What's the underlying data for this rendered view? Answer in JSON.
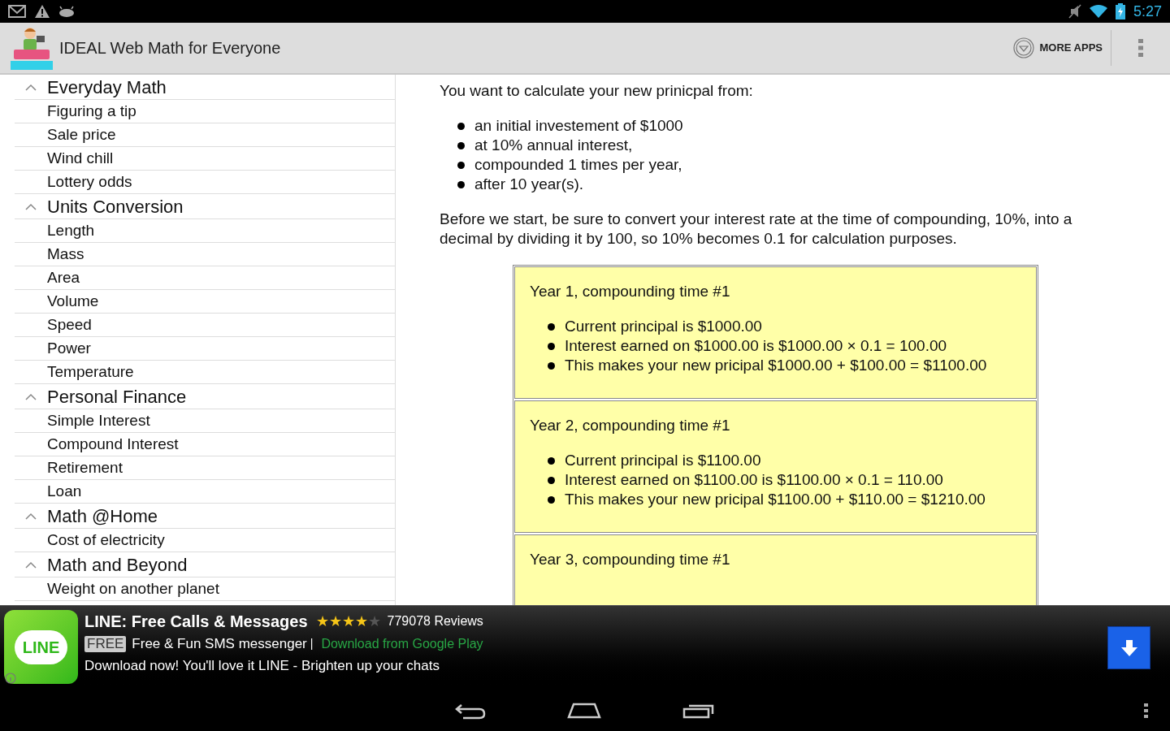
{
  "status_bar": {
    "time": "5:27"
  },
  "action_bar": {
    "title": "IDEAL Web Math for Everyone",
    "more_apps": "MORE APPS"
  },
  "sidebar": {
    "groups": [
      {
        "label": "Everyday Math",
        "expanded": true,
        "children": [
          {
            "label": "Figuring a tip"
          },
          {
            "label": "Sale price"
          },
          {
            "label": "Wind chill"
          },
          {
            "label": "Lottery odds"
          }
        ]
      },
      {
        "label": "Units Conversion",
        "expanded": true,
        "children": [
          {
            "label": "Length"
          },
          {
            "label": "Mass"
          },
          {
            "label": "Area"
          },
          {
            "label": "Volume"
          },
          {
            "label": "Speed"
          },
          {
            "label": "Power"
          },
          {
            "label": "Temperature"
          }
        ]
      },
      {
        "label": "Personal Finance",
        "expanded": true,
        "children": [
          {
            "label": "Simple Interest"
          },
          {
            "label": "Compound Interest"
          },
          {
            "label": "Retirement"
          },
          {
            "label": "Loan"
          }
        ]
      },
      {
        "label": "Math @Home",
        "expanded": true,
        "children": [
          {
            "label": "Cost of electricity"
          }
        ]
      },
      {
        "label": "Math and Beyond",
        "expanded": true,
        "children": [
          {
            "label": "Weight on another planet"
          }
        ]
      }
    ]
  },
  "content": {
    "intro": "You want to calculate your new prinicpal from:",
    "bullets": [
      "an initial investement of $1000",
      "at 10% annual interest,",
      "compounded 1 times per year,",
      "after 10 year(s)."
    ],
    "note": "Before we start, be sure to convert your interest rate at the time of compounding, 10%, into a decimal by dividing it by 100, so 10% becomes 0.1 for calculation purposes.",
    "years": [
      {
        "title": "Year 1, compounding time #1",
        "lines": [
          "Current principal is $1000.00",
          "Interest earned on $1000.00 is $1000.00 × 0.1 = 100.00",
          "This makes your new pricipal $1000.00 + $100.00 = $1100.00"
        ]
      },
      {
        "title": "Year 2, compounding time #1",
        "lines": [
          "Current principal is $1100.00",
          "Interest earned on $1100.00 is $1100.00 × 0.1 = 110.00",
          "This makes your new pricipal $1100.00 + $110.00 = $1210.00"
        ]
      },
      {
        "title": "Year 3, compounding time #1"
      }
    ]
  },
  "ad": {
    "title": "LINE: Free Calls & Messages",
    "stars": 4,
    "reviews": "779078 Reviews",
    "badge": "FREE",
    "subtitle": "Free & Fun SMS messenger",
    "separator": "|",
    "store_link": "Download from Google Play",
    "description": "Download now! You'll love it LINE - Brighten up your chats",
    "app_icon_text": "LINE"
  }
}
